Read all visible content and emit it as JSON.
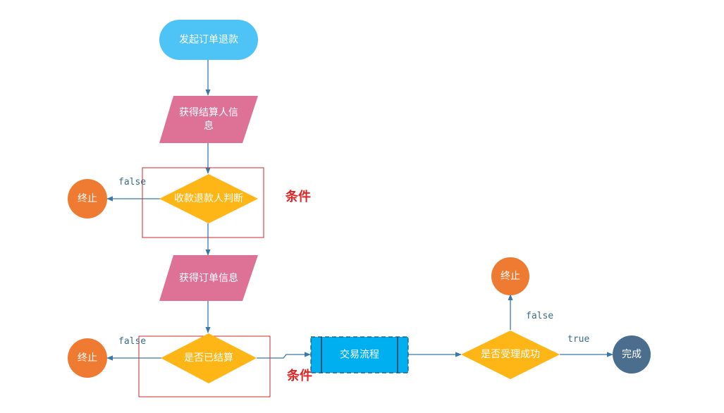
{
  "nodes": {
    "start": "发起订单退款",
    "get_settler_line1": "获得结算人信",
    "get_settler_line2": "息",
    "judge_payee": "收款退款人判断",
    "end1": "终止",
    "get_order": "获得订单信息",
    "is_settled": "是否已结算",
    "end2": "终止",
    "trade_flow": "交易流程",
    "accept_success": "是否受理成功",
    "end3": "终止",
    "done": "完成"
  },
  "edges": {
    "false1": "false",
    "false2": "false",
    "false3": "false",
    "true1": "true"
  },
  "annotations": {
    "condition1": "条件",
    "condition2": "条件"
  },
  "colors": {
    "terminal_blue": "#4dc4f5",
    "parallelogram_pink": "#de7196",
    "decision_yellow": "#fdb615",
    "end_orange": "#ef7a31",
    "done_steel": "#4b6e8e",
    "process_cyan": "#00afef",
    "edge_blue": "#3a78aa",
    "highlight_red": "#cc2a2a"
  }
}
